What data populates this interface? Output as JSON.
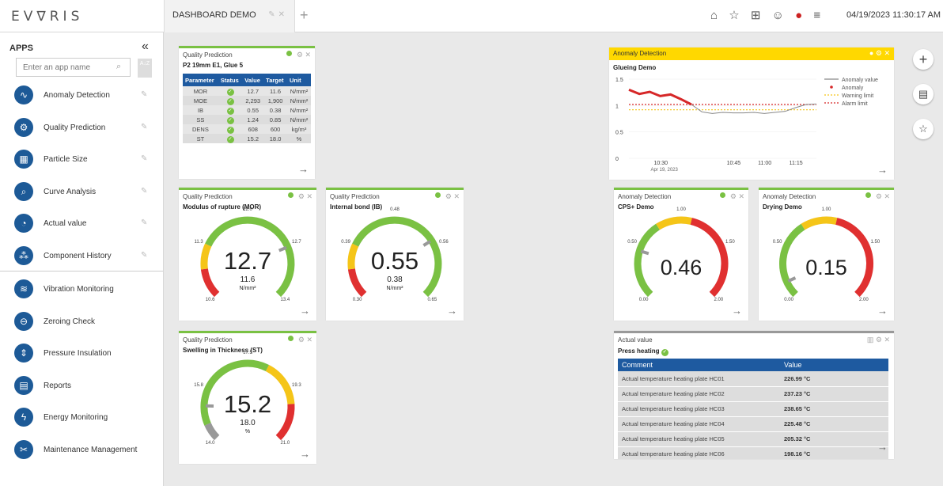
{
  "topbar": {
    "logo": "EV∇RIS",
    "tab_label": "DASHBOARD DEMO",
    "datetime": "04/19/2023 11:30:17 AM",
    "icons": [
      "home-icon",
      "star-icon",
      "grid-icon",
      "user-icon",
      "flag-us-icon",
      "menu-icon"
    ]
  },
  "sidebar": {
    "title": "APPS",
    "search_placeholder": "Enter an app name",
    "sort_label": "A↓Z",
    "pinned": [
      {
        "label": "Anomaly Detection",
        "icon": "pulse-icon"
      },
      {
        "label": "Quality Prediction",
        "icon": "gear-icon"
      },
      {
        "label": "Particle Size",
        "icon": "chart-icon"
      },
      {
        "label": "Curve Analysis",
        "icon": "magnifier-icon"
      },
      {
        "label": "Actual value",
        "icon": "gauge-icon"
      },
      {
        "label": "Component History",
        "icon": "components-icon"
      }
    ],
    "others": [
      {
        "label": "Vibration Monitoring",
        "icon": "vibration-icon"
      },
      {
        "label": "Zeroing Check",
        "icon": "zero-icon"
      },
      {
        "label": "Pressure Insulation",
        "icon": "pressure-icon"
      },
      {
        "label": "Reports",
        "icon": "report-icon"
      },
      {
        "label": "Energy Monitoring",
        "icon": "energy-icon"
      },
      {
        "label": "Maintenance Management",
        "icon": "tools-icon"
      }
    ]
  },
  "qp_table": {
    "title": "Quality Prediction",
    "subtitle": "P2 19mm E1, Glue 5",
    "headers": [
      "Parameter",
      "Status",
      "Value",
      "Target",
      "Unit"
    ],
    "rows": [
      [
        "MOR",
        "12.7",
        "11.6",
        "N/mm²"
      ],
      [
        "MOE",
        "2,293",
        "1,900",
        "N/mm²"
      ],
      [
        "IB",
        "0.55",
        "0.38",
        "N/mm²"
      ],
      [
        "SS",
        "1.24",
        "0.85",
        "N/mm²"
      ],
      [
        "DENS",
        "608",
        "600",
        "kg/m³"
      ],
      [
        "ST",
        "15.2",
        "18.0",
        "%"
      ]
    ]
  },
  "gauges": {
    "mor": {
      "title": "Quality Prediction",
      "subtitle": "Modulus of rupture (MOR)",
      "value": "12.7",
      "target": "11.6",
      "unit": "N/mm²",
      "min_label": "10.6",
      "max_label": "13.4",
      "top_label": "12.0",
      "left_label": "11.3",
      "right_label": "12.7",
      "value_num": 12.7,
      "min": 10.6,
      "max": 13.4
    },
    "ib": {
      "title": "Quality Prediction",
      "subtitle": "Internal bond (IB)",
      "value": "0.55",
      "target": "0.38",
      "unit": "N/mm²",
      "min_label": "0.30",
      "max_label": "0.65",
      "top_label": "0.48",
      "left_label": "0.39",
      "right_label": "0.56",
      "value_num": 0.55,
      "min": 0.3,
      "max": 0.65
    },
    "st": {
      "title": "Quality Prediction",
      "subtitle": "Swelling in Thickness (ST)",
      "value": "15.2",
      "target": "18.0",
      "unit": "%",
      "min_label": "14.0",
      "max_label": "21.0",
      "top_label": "17.5",
      "left_label": "15.8",
      "right_label": "19.3",
      "value_num": 15.2,
      "min": 14.0,
      "max": 21.0
    },
    "cps": {
      "title": "Anomaly Detection",
      "subtitle": "CPS+ Demo",
      "value": "0.46",
      "min_label": "0.00",
      "max_label": "2.00",
      "top_label": "1.00",
      "left_label": "0.50",
      "right_label": "1.50",
      "value_num": 0.46,
      "min": 0,
      "max": 2
    },
    "dry": {
      "title": "Anomaly Detection",
      "subtitle": "Drying Demo",
      "value": "0.15",
      "min_label": "0.00",
      "max_label": "2.00",
      "top_label": "1.00",
      "left_label": "0.50",
      "right_label": "1.50",
      "value_num": 0.15,
      "min": 0,
      "max": 2
    }
  },
  "anomaly": {
    "title": "Anomaly Detection",
    "subtitle": "Glueing Demo"
  },
  "chart_data": {
    "type": "line",
    "x": [
      "10:25",
      "10:27",
      "10:29",
      "10:30",
      "10:31",
      "10:32",
      "10:33",
      "10:35",
      "10:37",
      "10:40",
      "10:45",
      "10:50",
      "10:55",
      "11:00",
      "11:05",
      "11:10",
      "11:15",
      "11:20",
      "11:24"
    ],
    "series": [
      {
        "name": "Anomaly value",
        "values": [
          1.3,
          1.22,
          1.26,
          1.18,
          1.21,
          1.12,
          1.02,
          0.88,
          0.85,
          0.87,
          0.86,
          0.86,
          0.87,
          0.85,
          0.87,
          0.89,
          0.96,
          1.02,
          1.03
        ]
      },
      {
        "name": "Anomaly",
        "values": [
          1.3,
          1.22,
          1.26,
          1.18,
          1.21,
          1.12,
          1.02,
          null,
          null,
          null,
          null,
          null,
          null,
          null,
          null,
          null,
          null,
          null,
          null
        ]
      },
      {
        "name": "Warning limit",
        "values": [
          0.92,
          0.92,
          0.92,
          0.92,
          0.92,
          0.92,
          0.92,
          0.92,
          0.92,
          0.92,
          0.92,
          0.92,
          0.92,
          0.92,
          0.92,
          0.92,
          0.92,
          0.92,
          0.92
        ]
      },
      {
        "name": "Alarm limit",
        "values": [
          1.02,
          1.02,
          1.02,
          1.02,
          1.02,
          1.02,
          1.02,
          1.02,
          1.02,
          1.02,
          1.02,
          1.02,
          1.02,
          1.02,
          1.02,
          1.02,
          1.02,
          1.02,
          1.02
        ]
      }
    ],
    "xticks": [
      "10:30",
      "10:45",
      "11:00",
      "11:15"
    ],
    "xtick_sub": "Apr 19, 2023",
    "yticks": [
      "0",
      "0.5",
      "1",
      "1.5"
    ],
    "ylim": [
      0,
      1.5
    ],
    "legend": "top-right",
    "colors": {
      "value": "#888888",
      "anomaly": "#d62728",
      "warning": "#f5c518",
      "alarm": "#d62728"
    }
  },
  "actual": {
    "title": "Actual value",
    "subtitle": "Press heating",
    "headers": [
      "Comment",
      "Value"
    ],
    "rows": [
      [
        "Actual temperature heating plate HC01",
        "226.99 °C"
      ],
      [
        "Actual temperature heating plate HC02",
        "237.23 °C"
      ],
      [
        "Actual temperature heating plate HC03",
        "238.65 °C"
      ],
      [
        "Actual temperature heating plate HC04",
        "225.48 °C"
      ],
      [
        "Actual temperature heating plate HC05",
        "205.32 °C"
      ],
      [
        "Actual temperature heating plate HC06",
        "198.16 °C"
      ]
    ]
  },
  "fabs": [
    "add-icon",
    "report-add-icon",
    "favorite-add-icon"
  ]
}
